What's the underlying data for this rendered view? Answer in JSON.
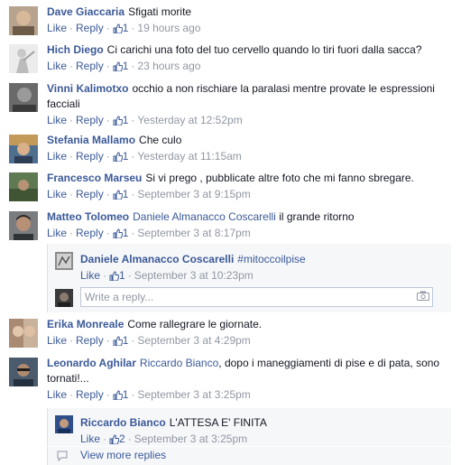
{
  "actions": {
    "like": "Like",
    "reply": "Reply",
    "dot": "·"
  },
  "comments": [
    {
      "author": "Dave Giaccaria",
      "text": "Sfigati morite",
      "likes": "1",
      "time": "19 hours ago"
    },
    {
      "author": "Hich Diego",
      "text": "Ci carichi una foto del tuo cervello quando lo tiri fuori dalla sacca?",
      "likes": "1",
      "time": "23 hours ago"
    },
    {
      "author": "Vinni Kalimotxo",
      "text": "occhio a non rischiare la paralasi mentre provate le espressioni facciali",
      "likes": "1",
      "time": "Yesterday at 12:52pm"
    },
    {
      "author": "Stefania Mallamo",
      "text": "Che culo",
      "likes": "1",
      "time": "Yesterday at 11:15am"
    },
    {
      "author": "Francesco Marseu",
      "text": "Si vi prego , pubblicate altre foto che mi fanno sbregare.",
      "likes": "1",
      "time": "September 3 at 9:15pm"
    },
    {
      "author": "Matteo Tolomeo",
      "tag": "Daniele Almanacco Coscarelli",
      "text": "il grande ritorno",
      "likes": "1",
      "time": "September 3 at 8:17pm"
    },
    {
      "author": "Erika Monreale",
      "text": "Come rallegrare le giornate.",
      "likes": "1",
      "time": "September 3 at 4:29pm"
    },
    {
      "author": "Leonardo Aghilar",
      "tag": "Riccardo Bianco",
      "text": ", dopo i maneggiamenti di pise e di pata, sono tornati!...",
      "likes": "1",
      "time": "September 3 at 3:25pm"
    }
  ],
  "replies": [
    {
      "author": "Daniele Almanacco Coscarelli",
      "tag": "#mitoccoilpise",
      "likes": "1",
      "time": "September 3 at 10:23pm"
    },
    {
      "author": "Riccardo Bianco",
      "text": "L'ATTESA E' FINITA",
      "likes": "2",
      "time": "September 3 at 3:25pm"
    }
  ],
  "write_reply": {
    "placeholder": "Write a reply..."
  },
  "more_replies": {
    "label": "View more replies"
  },
  "colors": {
    "link": "#3b5998",
    "meta": "#9197a3",
    "text": "#141823",
    "reply_bg": "#f6f7f9"
  }
}
